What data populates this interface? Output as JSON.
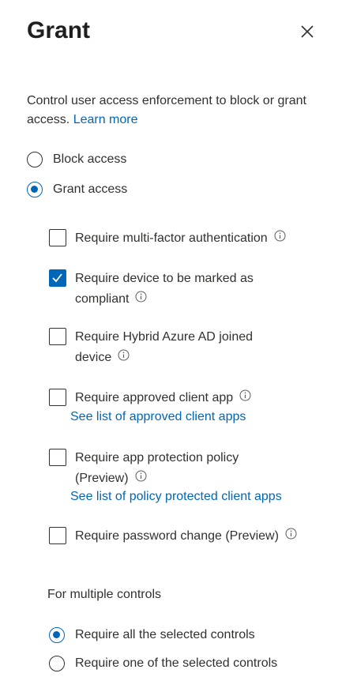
{
  "panel": {
    "title": "Grant",
    "close_icon": "close-icon"
  },
  "description": {
    "text": "Control user access enforcement to block or grant access. ",
    "link": "Learn more"
  },
  "access_options": {
    "block": "Block access",
    "grant": "Grant access",
    "selected": "grant"
  },
  "controls": [
    {
      "label": "Require multi-factor authentication",
      "checked": false
    },
    {
      "label": "Require device to be marked as compliant",
      "checked": true
    },
    {
      "label": "Require Hybrid Azure AD joined device",
      "checked": false
    },
    {
      "label": "Require approved client app",
      "checked": false,
      "link": "See list of approved client apps"
    },
    {
      "label": "Require app protection policy (Preview)",
      "checked": false,
      "link": "See list of policy protected client apps"
    },
    {
      "label": "Require password change (Preview)",
      "checked": false
    }
  ],
  "multiple_controls": {
    "heading": "For multiple controls",
    "require_all": "Require all the selected controls",
    "require_one": "Require one of the selected controls",
    "selected": "require_all"
  },
  "colors": {
    "accent": "#0067b8",
    "text": "#323130"
  }
}
